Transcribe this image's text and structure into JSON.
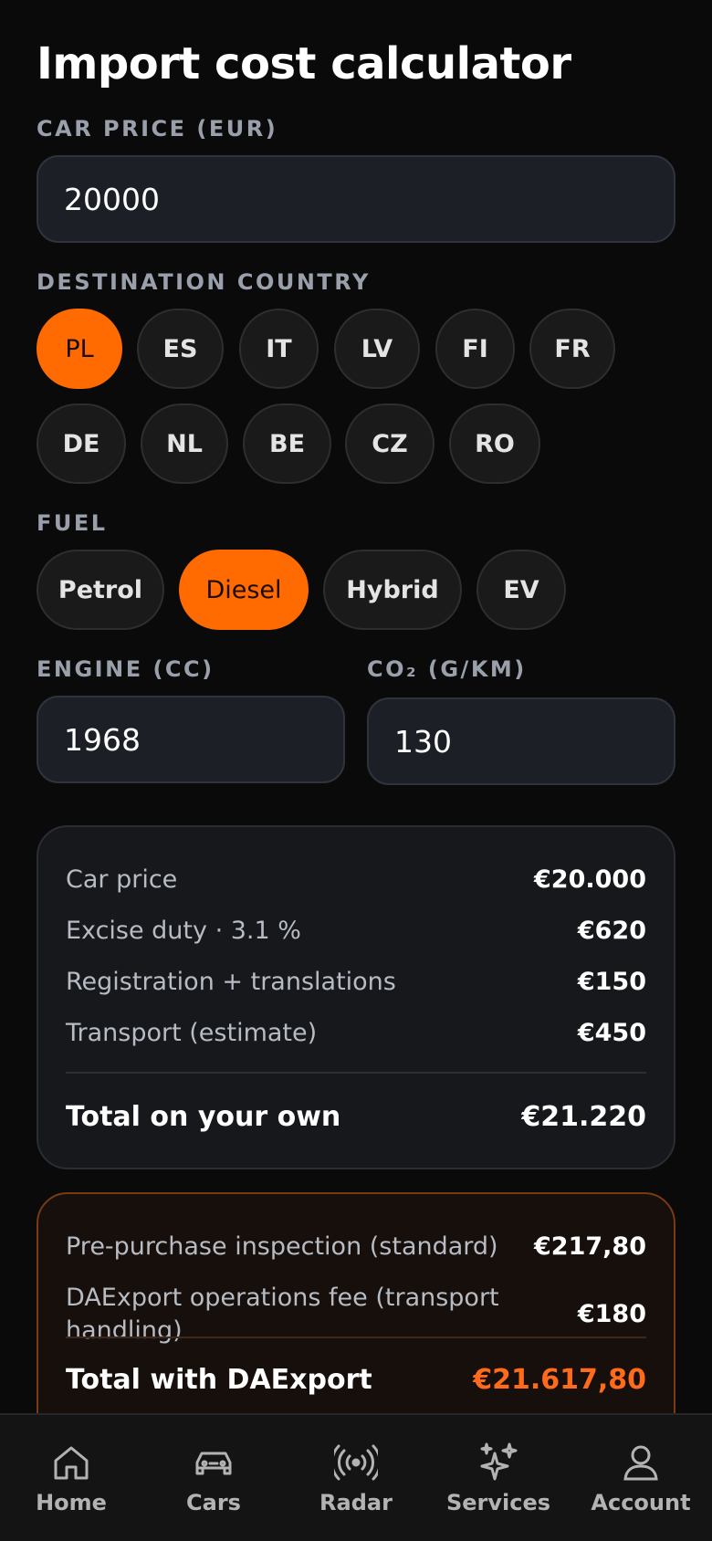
{
  "title": "Import cost calculator",
  "price": {
    "label": "CAR PRICE (EUR)",
    "value": "20000"
  },
  "destination": {
    "label": "DESTINATION COUNTRY",
    "countries": [
      "PL",
      "ES",
      "IT",
      "LV",
      "FI",
      "FR",
      "DE",
      "NL",
      "BE",
      "CZ",
      "RO"
    ],
    "selected": "PL"
  },
  "fuel": {
    "label": "FUEL",
    "options": [
      "Petrol",
      "Diesel",
      "Hybrid",
      "EV"
    ],
    "selected": "Diesel"
  },
  "engine": {
    "label": "ENGINE (CC)",
    "value": "1968"
  },
  "co2": {
    "label": "CO₂ (G/KM)",
    "value": "130"
  },
  "own": {
    "rows": [
      {
        "label": "Car price",
        "value": "€20.000"
      },
      {
        "label": "Excise duty · 3.1 %",
        "value": "€620"
      },
      {
        "label": "Registration + translations",
        "value": "€150"
      },
      {
        "label": "Transport (estimate)",
        "value": "€450"
      }
    ],
    "total_label": "Total on your own",
    "total_value": "€21.220"
  },
  "daexport": {
    "rows": [
      {
        "label": "Pre-purchase inspection (standard)",
        "value": "€217,80"
      },
      {
        "label": "DAExport operations fee (transport handling)",
        "value": "€180"
      }
    ],
    "total_label": "Total with DAExport",
    "total_value": "€21.617,80"
  },
  "nav": {
    "items": [
      {
        "label": "Home",
        "icon": "home-icon"
      },
      {
        "label": "Cars",
        "icon": "car-icon"
      },
      {
        "label": "Radar",
        "icon": "radar-icon"
      },
      {
        "label": "Services",
        "icon": "sparkles-icon"
      },
      {
        "label": "Account",
        "icon": "user-icon"
      }
    ]
  },
  "colors": {
    "accent": "#ff6b00",
    "background": "#0a0a0a",
    "card": "#16181c"
  }
}
